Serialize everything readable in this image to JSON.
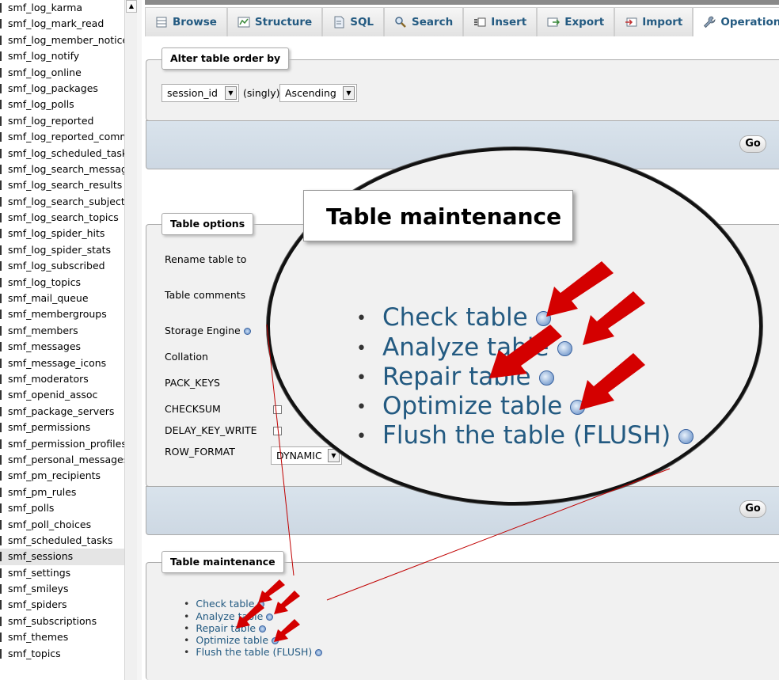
{
  "sidebar": {
    "tables": [
      "smf_log_karma",
      "smf_log_mark_read",
      "smf_log_member_notices",
      "smf_log_notify",
      "smf_log_online",
      "smf_log_packages",
      "smf_log_polls",
      "smf_log_reported",
      "smf_log_reported_comments",
      "smf_log_scheduled_tasks",
      "smf_log_search_messages",
      "smf_log_search_results",
      "smf_log_search_subjects",
      "smf_log_search_topics",
      "smf_log_spider_hits",
      "smf_log_spider_stats",
      "smf_log_subscribed",
      "smf_log_topics",
      "smf_mail_queue",
      "smf_membergroups",
      "smf_members",
      "smf_messages",
      "smf_message_icons",
      "smf_moderators",
      "smf_openid_assoc",
      "smf_package_servers",
      "smf_permissions",
      "smf_permission_profiles",
      "smf_personal_messages",
      "smf_pm_recipients",
      "smf_pm_rules",
      "smf_polls",
      "smf_poll_choices",
      "smf_scheduled_tasks",
      "smf_sessions",
      "smf_settings",
      "smf_smileys",
      "smf_spiders",
      "smf_subscriptions",
      "smf_themes",
      "smf_topics"
    ],
    "active": "smf_sessions"
  },
  "tabs": [
    {
      "label": "Browse",
      "icon": "browse-icon"
    },
    {
      "label": "Structure",
      "icon": "structure-icon"
    },
    {
      "label": "SQL",
      "icon": "sql-icon"
    },
    {
      "label": "Search",
      "icon": "search-icon"
    },
    {
      "label": "Insert",
      "icon": "insert-icon"
    },
    {
      "label": "Export",
      "icon": "export-icon"
    },
    {
      "label": "Import",
      "icon": "import-icon"
    },
    {
      "label": "Operations",
      "icon": "wrench-icon",
      "active": true
    }
  ],
  "alter_order": {
    "legend": "Alter table order by",
    "column_value": "session_id",
    "singly_label": "(singly)",
    "direction_value": "Ascending",
    "go_label": "Go"
  },
  "table_options": {
    "legend": "Table options",
    "rows": [
      "Rename table to",
      "Table comments",
      "Storage Engine",
      "Collation",
      "PACK_KEYS",
      "CHECKSUM",
      "DELAY_KEY_WRITE",
      "ROW_FORMAT"
    ],
    "row_format_value": "DYNAMIC",
    "go_label": "Go"
  },
  "maintenance": {
    "legend": "Table maintenance",
    "links": [
      "Check table",
      "Analyze table",
      "Repair table",
      "Optimize table",
      "Flush the table (FLUSH)"
    ]
  },
  "zoom": {
    "legend": "Table maintenance",
    "links": [
      "Check table",
      "Analyze table",
      "Repair table",
      "Optimize table",
      "Flush the table (FLUSH)"
    ]
  },
  "colors": {
    "link": "#235a81",
    "arrow": "#d40000",
    "annotation_line": "#c00000"
  }
}
